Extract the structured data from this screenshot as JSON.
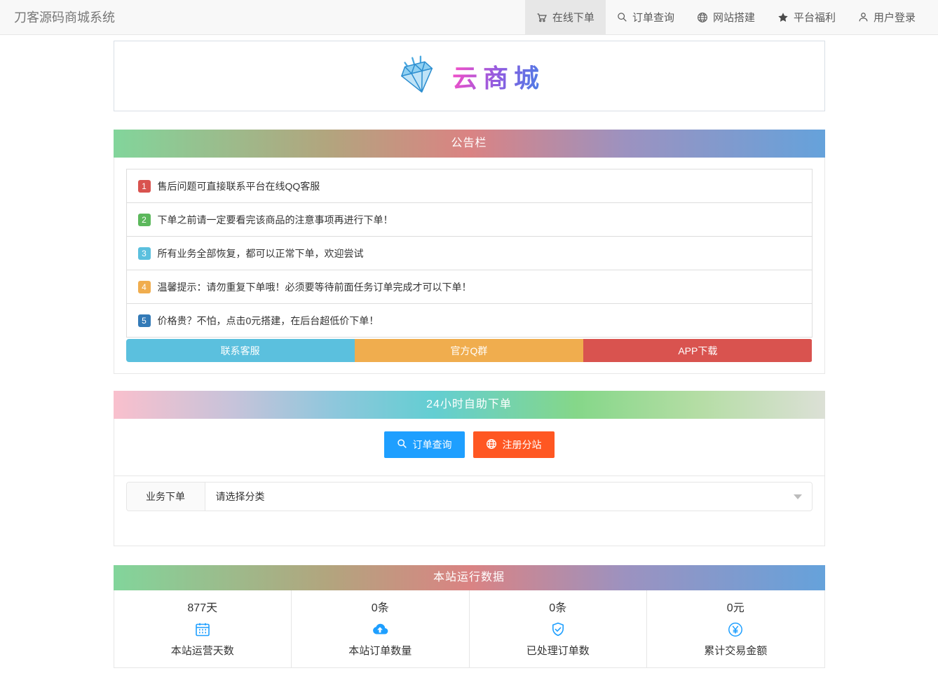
{
  "navbar": {
    "brand": "刀客源码商城系统",
    "items": [
      {
        "label": "在线下单",
        "icon": "cart-icon",
        "active": true
      },
      {
        "label": "订单查询",
        "icon": "search-icon",
        "active": false
      },
      {
        "label": "网站搭建",
        "icon": "globe-icon",
        "active": false
      },
      {
        "label": "平台福利",
        "icon": "star-icon",
        "active": false
      },
      {
        "label": "用户登录",
        "icon": "user-icon",
        "active": false
      }
    ]
  },
  "logo": {
    "icon": "diamond-gem-icon",
    "text": "云商城",
    "gradient_colors": [
      "#f050c8",
      "#8e5ce0",
      "#4a7de6"
    ]
  },
  "announcement": {
    "title": "公告栏",
    "items": [
      {
        "num": "1",
        "color": "#d9534f",
        "text": "售后问题可直接联系平台在线QQ客服"
      },
      {
        "num": "2",
        "color": "#5cb85c",
        "text": "下单之前请一定要看完该商品的注意事项再进行下单！"
      },
      {
        "num": "3",
        "color": "#5bc0de",
        "text": "所有业务全部恢复，都可以正常下单，欢迎尝试"
      },
      {
        "num": "4",
        "color": "#f0ad4e",
        "text": "温馨提示：请勿重复下单哦！必须要等待前面任务订单完成才可以下单！"
      },
      {
        "num": "5",
        "color": "#337ab7",
        "text": "价格贵？不怕，点击0元搭建，在后台超低价下单！"
      }
    ],
    "buttons": [
      {
        "label": "联系客服",
        "color": "#5bc0de"
      },
      {
        "label": "官方Q群",
        "color": "#f0ad4e"
      },
      {
        "label": "APP下载",
        "color": "#d9534f"
      }
    ]
  },
  "selfservice": {
    "title": "24小时自助下单",
    "buttons": [
      {
        "label": "订单查询",
        "color": "#1E9FFF",
        "icon": "search-icon"
      },
      {
        "label": "注册分站",
        "color": "#FF5722",
        "icon": "globe-icon"
      }
    ],
    "form": {
      "label": "业务下单",
      "select_placeholder": "请选择分类"
    }
  },
  "stats": {
    "title": "本站运行数据",
    "icon_color": "#1E9FFF",
    "items": [
      {
        "value": "877天",
        "icon": "calendar-icon",
        "label": "本站运营天数"
      },
      {
        "value": "0条",
        "icon": "cloud-upload-icon",
        "label": "本站订单数量"
      },
      {
        "value": "0条",
        "icon": "shield-check-icon",
        "label": "已处理订单数"
      },
      {
        "value": "0元",
        "icon": "yen-circle-icon",
        "label": "累计交易金额"
      }
    ]
  }
}
